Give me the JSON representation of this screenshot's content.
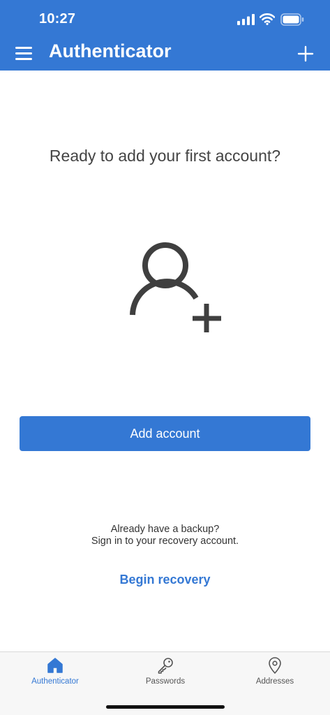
{
  "status_bar": {
    "time": "10:27"
  },
  "header": {
    "title": "Authenticator"
  },
  "main": {
    "headline": "Ready to add your first account?",
    "add_account_label": "Add account",
    "backup_question": "Already have a backup?",
    "backup_instruction": "Sign in to your recovery account.",
    "recovery_link": "Begin recovery"
  },
  "tabbar": {
    "tabs": [
      {
        "label": "Authenticator",
        "icon": "home-icon",
        "active": true
      },
      {
        "label": "Passwords",
        "icon": "key-icon",
        "active": false
      },
      {
        "label": "Addresses",
        "icon": "location-pin-icon",
        "active": false
      }
    ]
  },
  "colors": {
    "accent": "#3478d4",
    "background": "#ffffff",
    "text": "#444444"
  }
}
